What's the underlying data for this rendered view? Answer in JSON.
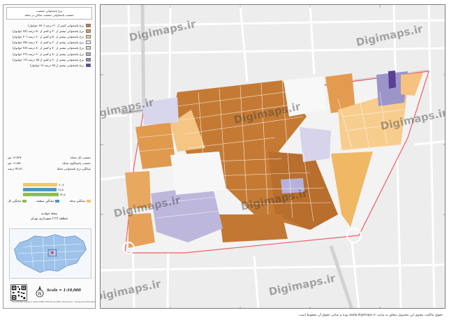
{
  "legend": {
    "title_line1": "نرخ پاسخوانی جمعیت",
    "title_line2": "جمعیت پاسخوانی جمعیت ساکن در محله",
    "classes": [
      {
        "label": "نرخ پاسخوانی کمتر از ۳۰ درصد (۳۸۰ خوانوار)",
        "color": "#c7782f"
      },
      {
        "label": "نرخ پاسخوانی بیشتر از ۳۰ و کمتر از ۵۰ درصد (۷۷ خوانوار)",
        "color": "#e09a4e"
      },
      {
        "label": "نرخ پاسخوانی بیشتر از ۵۰ و کمتر از ۶۰ درصد (۴۰ خوانوار)",
        "color": "#f7cd8e"
      },
      {
        "label": "نرخ پاسخوانی بیشتر از ۶۰ و کمتر از ۷۰ درصد (۳۵ خوانوار)",
        "color": "#f3f3f3"
      },
      {
        "label": "نرخ پاسخوانی بیشتر از ۷۰ و کمتر از ۸۰ درصد (۲۸ خوانوار)",
        "color": "#d8d6ec"
      },
      {
        "label": "نرخ پاسخوانی بیشتر از ۸۰ و کمتر از ۹۰ درصد (۲۲ خوانوار)",
        "color": "#b1acd6"
      },
      {
        "label": "نرخ پاسخوانی بیشتر از ۹۰ و کمتر از ۹۵ درصد (۱۲ خوانوار)",
        "color": "#8d86c0"
      },
      {
        "label": "نرخ پاسخوانی بیشتر از ۹۵ درصد (۹ خوانوار)",
        "color": "#5a3f94"
      }
    ],
    "stats": [
      {
        "label": "جمعیت کل محله:",
        "value": "۱۶،۴۳۷ نفر"
      },
      {
        "label": "جمعیت پاسخگوی محله:",
        "value": "۱۱،۹۵۱ نفر"
      },
      {
        "label": "میانگین نرخ پاسخوانی محله:",
        "value": "۷۲٫۷۱ درصد"
      }
    ],
    "bars": [
      {
        "label": "۷۰٫۲",
        "value": 70.2,
        "color": "#f5c66b"
      },
      {
        "label": "۶۸٫۸",
        "value": 68.8,
        "color": "#4a97c9"
      },
      {
        "label": "۷۲٫۷",
        "value": 72.7,
        "color": "#8cc04d"
      }
    ],
    "mini_legend": [
      {
        "label": "میانگین کل",
        "color": "#8cc04d"
      },
      {
        "label": "میانگین منطقه",
        "color": "#4a97c9"
      },
      {
        "label": "میانگین محله",
        "color": "#f5c66b"
      }
    ],
    "neighborhood_label": "محله جوادیه",
    "district_label": "منطقه (۱۲) شهرداری تهران",
    "scale": "Scale = 1:10,000",
    "north_letter": "N",
    "credits": "Coordinate System: WGS 1984 UTM Zone 39N | Projection: Transverse Mercator"
  },
  "map": {
    "watermarks": [
      "Digimaps.ir",
      "Digimaps.ir",
      "Digimaps.ir",
      "Digimaps.ir",
      "Digimaps.ir",
      "Digimaps.ir",
      "Digimaps.ir",
      "Digimaps.ir",
      "Digimaps.ir"
    ]
  },
  "footer": {
    "text": "حقوق مالکیت معنوی این محصول متعلق به سایت www.digimaps.ir بوده و تمامی حقوق آن محفوظ است."
  }
}
